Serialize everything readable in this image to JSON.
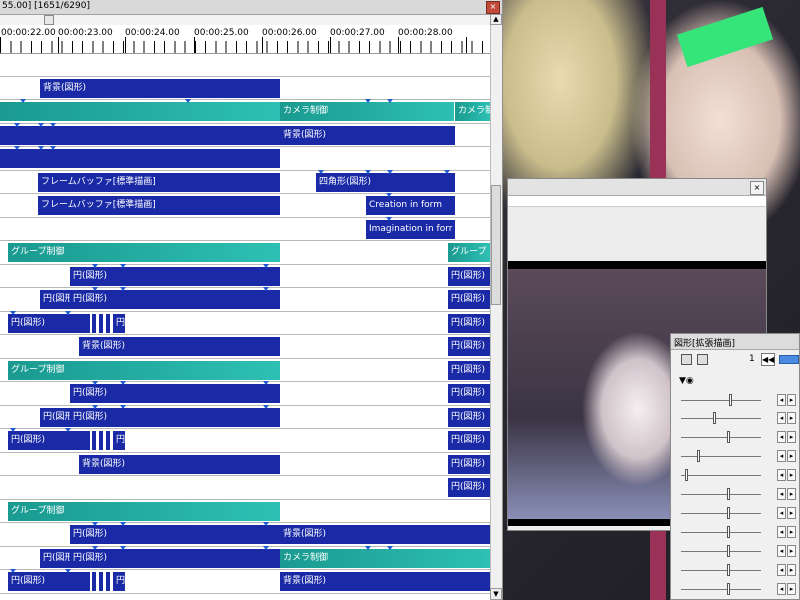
{
  "timeline": {
    "title": "55.00] [1651/6290]",
    "ticks": [
      "00:00:22.00",
      "00:00:23.00",
      "00:00:24.00",
      "00:00:25.00",
      "00:00:26.00",
      "00:00:27.00",
      "00:00:28.00"
    ]
  },
  "clip_labels": {
    "haikei": "背景(図形)",
    "camera": "カメラ制御",
    "camera_short": "カメラ制",
    "framebuffer": "フレームバッファ[標準描画]",
    "shikaku": "四角形(図形)",
    "creation": "Creation in form",
    "imagination": "Imagination in forr",
    "group": "グループ制御",
    "group_short": "グループ",
    "en": "円(図形)",
    "en_short": "円(図形",
    "en_tiny": "円"
  },
  "settings": {
    "title": "図形[拡張描画]",
    "frame_value": "1",
    "prev_label": "◀◀"
  },
  "colors": {
    "clip_navy": "#1a2aa6",
    "clip_teal": "#2ec0b4",
    "marker": "#1e5ad0"
  },
  "icons": [
    "close-icon",
    "scroll-up-icon",
    "scroll-down-icon",
    "camera-icon",
    "eye-icon",
    "prev-keyframe-icon"
  ]
}
